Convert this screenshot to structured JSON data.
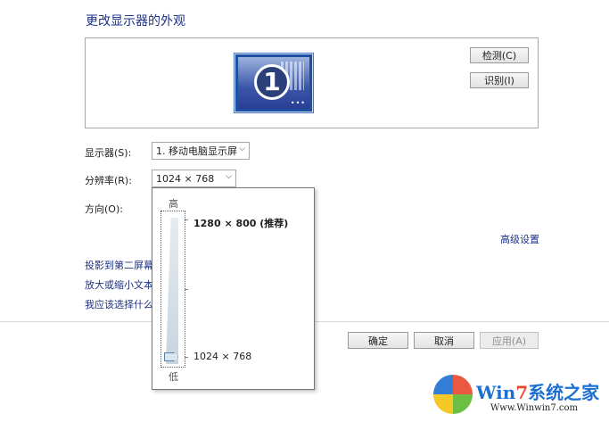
{
  "header": {
    "title": "更改显示器的外观"
  },
  "preview": {
    "monitor_number": "1",
    "detect_label": "检测(C)",
    "identify_label": "识别(I)"
  },
  "settings": {
    "display_label": "显示器(S):",
    "display_value": "1. 移动电脑显示屏",
    "resolution_label": "分辨率(R):",
    "resolution_value": "1024 × 768",
    "orientation_label": "方向(O):",
    "advanced_link": "高级设置"
  },
  "links": {
    "project": "投影到第二屏幕",
    "text_size": "放大或缩小文本",
    "help": "我应该选择什么"
  },
  "resolution_popup": {
    "high_label": "高",
    "low_label": "低",
    "recommended": "1280 × 800 (推荐)",
    "current": "1024 × 768",
    "level_fraction": 0
  },
  "footer": {
    "ok_label": "确定",
    "cancel_label": "取消",
    "apply_label": "应用(A)"
  },
  "watermark": {
    "brand_prefix": "Win",
    "brand_seven": "7",
    "brand_suffix": "系统之家",
    "url": "Www.Winwin7.com"
  },
  "colors": {
    "title_blue": "#1e3287",
    "link_blue": "#1e3287",
    "monitor_blue": "#1e4fa0"
  }
}
